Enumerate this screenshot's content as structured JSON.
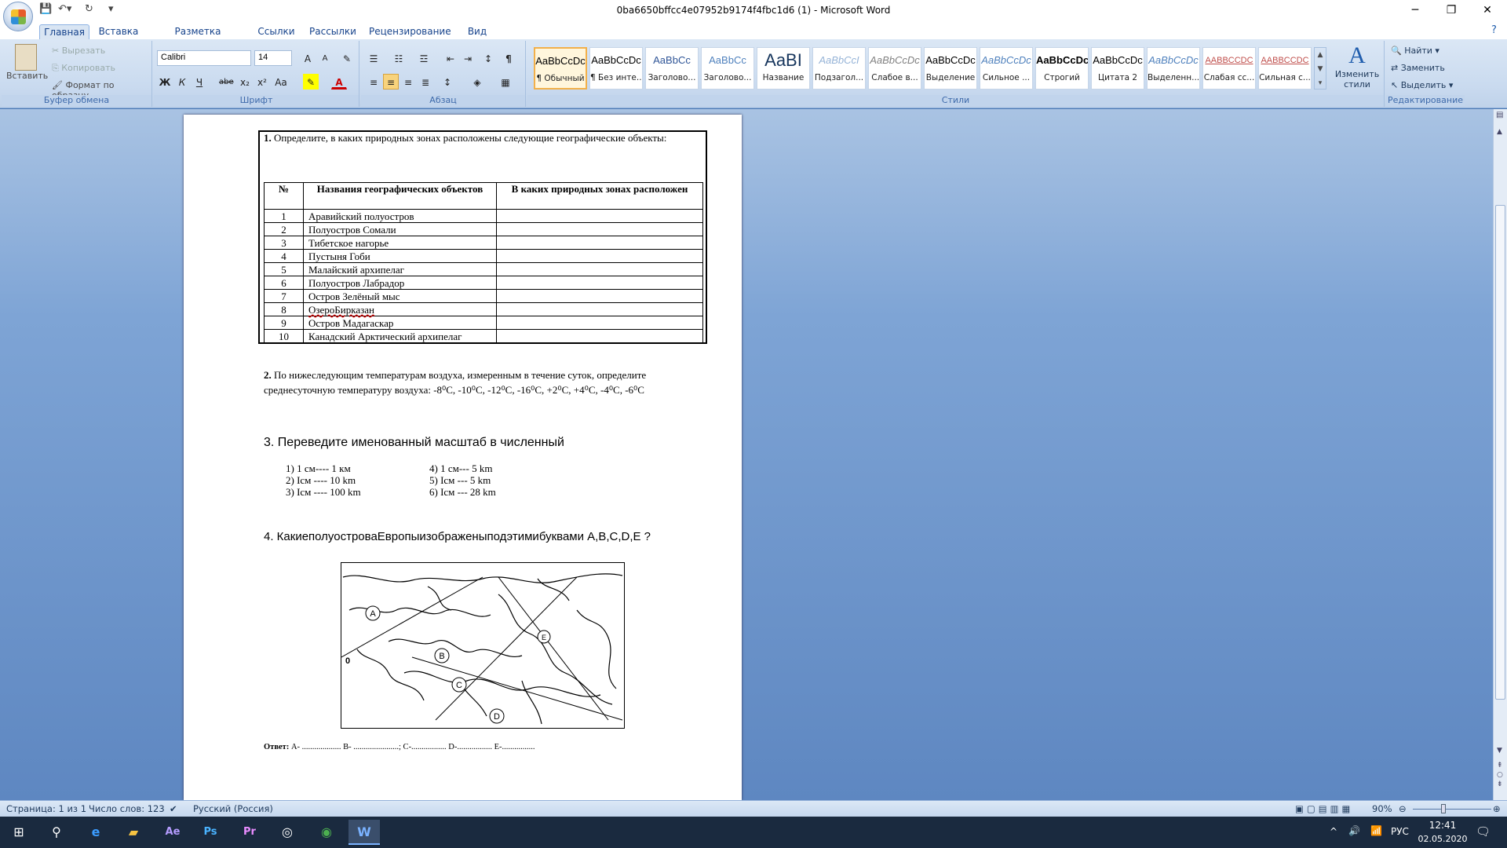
{
  "window": {
    "title": "0ba6650bffcc4e07952b9174f4fbc1d6 (1) - Microsoft Word"
  },
  "tabs": [
    "Главная",
    "Вставка",
    "Разметка страницы",
    "Ссылки",
    "Рассылки",
    "Рецензирование",
    "Вид"
  ],
  "clipboard": {
    "paste": "Вставить",
    "cut": "Вырезать",
    "copy": "Копировать",
    "format_painter": "Формат по образцу",
    "label": "Буфер обмена"
  },
  "font": {
    "name": "Calibri",
    "size": "14",
    "label": "Шрифт",
    "bold": "Ж",
    "italic": "К",
    "underline": "Ч",
    "strike": "abe",
    "sub": "x₂",
    "sup": "x²",
    "case": "Aa"
  },
  "paragraph": {
    "label": "Абзац"
  },
  "styles": {
    "label": "Стили",
    "change": "Изменить стили",
    "items": [
      {
        "preview": "AaBbCcDc",
        "name": "¶ Обычный",
        "color": "#000000"
      },
      {
        "preview": "AaBbCcDc",
        "name": "¶ Без инте...",
        "color": "#000000"
      },
      {
        "preview": "AaBbCc",
        "name": "Заголово...",
        "color": "#2f5597"
      },
      {
        "preview": "AaBbCc",
        "name": "Заголово...",
        "color": "#4f81bd"
      },
      {
        "preview": "AaBI",
        "name": "Название",
        "color": "#17365d"
      },
      {
        "preview": "AaBbCcI",
        "name": "Подзагол...",
        "color": "#95b3d7"
      },
      {
        "preview": "AaBbCcDc",
        "name": "Слабое в...",
        "color": "#808080"
      },
      {
        "preview": "AaBbCcDc",
        "name": "Выделение",
        "color": "#000000"
      },
      {
        "preview": "AaBbCcDc",
        "name": "Сильное ...",
        "color": "#4f81bd"
      },
      {
        "preview": "AaBbCcDc",
        "name": "Строгий",
        "color": "#000000"
      },
      {
        "preview": "AaBbCcDc",
        "name": "Цитата 2",
        "color": "#000000"
      },
      {
        "preview": "AaBbCcDc",
        "name": "Выделенн...",
        "color": "#4f81bd"
      },
      {
        "preview": "AABBCCDC",
        "name": "Слабая сс...",
        "color": "#c0504d"
      },
      {
        "preview": "AABBCCDC",
        "name": "Сильная с...",
        "color": "#c0504d"
      }
    ]
  },
  "editing": {
    "find": "Найти",
    "replace": "Заменить",
    "select": "Выделить",
    "label": "Редактирование"
  },
  "doc": {
    "q1": "Определите, в каких природных зонах расположены следующие географические объекты:",
    "q1_num": "1.",
    "headers": [
      "№",
      "Названия географических объектов",
      "В каких природных зонах расположен"
    ],
    "rows": [
      {
        "n": "1",
        "name": "Аравийский полуостров"
      },
      {
        "n": "2",
        "name": "Полуостров Сомали"
      },
      {
        "n": "3",
        "name": "Тибетское нагорье"
      },
      {
        "n": "4",
        "name": "Пустыня Гоби"
      },
      {
        "n": "5",
        "name": "Малайский архипелаг"
      },
      {
        "n": "6",
        "name": "Полуостров Лабрадор"
      },
      {
        "n": "7",
        "name": "Остров Зелёный мыс"
      },
      {
        "n": "8",
        "name": "ОзероБирказан"
      },
      {
        "n": "9",
        "name": "Остров Мадагаскар"
      },
      {
        "n": "10",
        "name": "Канадский Арктический архипелаг"
      }
    ],
    "q2_num": "2.",
    "q2_line1": "По нижеследующим  температурам воздуха, измеренным в течение суток, определите",
    "q2_line2": "среднесуточную температуру воздуха: -8⁰С,  -10⁰С, -12⁰С, -16⁰С, +2⁰С, +4⁰С, -4⁰С, -6⁰С",
    "q3": "3. Переведите именованный масштаб в численный",
    "scales_left": [
      "1)    1 см---- 1 км",
      "2)    Iсм ---- 10 km",
      "3)    Iсм ---- 100 km"
    ],
    "scales_right": [
      "4) 1 см--- 5 km",
      "5) Iсм ---   5 km",
      "6) Iсм --- 28 km"
    ],
    "q4": "4. КакиеполуостроваЕвропыизображеныподэтимибуквами  А,В,С,D,Е   ?",
    "map_labels": [
      "A",
      "B",
      "C",
      "D",
      "E",
      "0"
    ],
    "answer_label": "Ответ:",
    "answer_text": " А- ................... В- ......................; С-................. D-.................  Е-................"
  },
  "status": {
    "page": "Страница: 1 из 1",
    "words": "Число слов: 123",
    "lang": "Русский (Россия)",
    "zoom": "90%"
  },
  "tray": {
    "lang": "РУС",
    "time": "12:41",
    "date": "02.05.2020"
  }
}
